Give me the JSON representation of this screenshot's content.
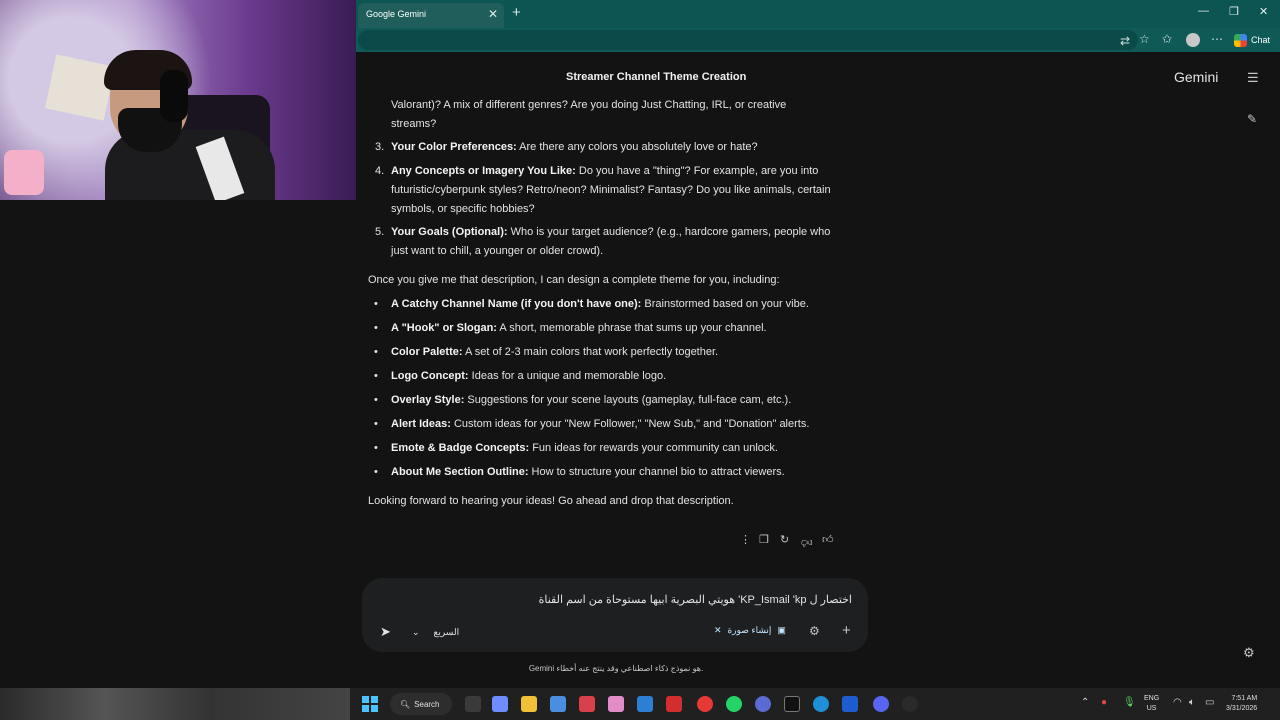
{
  "browser": {
    "tab_title": "Google Gemini",
    "tab_close": "✕",
    "new_tab": "+",
    "window_controls": [
      "—",
      "❐",
      "✕"
    ],
    "chat_label": "Chat"
  },
  "header": {
    "conversation_title": "Streamer Channel Theme Creation",
    "brand": "Gemini"
  },
  "response": {
    "continued_line_1": "Valorant)? A mix of different genres? Are you doing Just Chatting, IRL, or creative",
    "continued_line_2": "streams?",
    "numbered": [
      {
        "num": "3.",
        "label": "Your Color Preferences:",
        "line1": " Are there any colors you absolutely love or hate?",
        "line2": "",
        "line3": ""
      },
      {
        "num": "4.",
        "label": "Any Concepts or Imagery You Like:",
        "line1": " Do you have a \"thing\"? For example, are you into",
        "line2": "futuristic/cyberpunk styles? Retro/neon? Minimalist? Fantasy? Do you like animals, certain",
        "line3": "symbols, or specific hobbies?"
      },
      {
        "num": "5.",
        "label": "Your Goals (Optional):",
        "line1": " Who is your target audience? (e.g., hardcore gamers, people who",
        "line2": "just want to chill, a younger or older crowd).",
        "line3": ""
      }
    ],
    "intro": "Once you give me that description, I can design a complete theme for you, including:",
    "bullets": [
      {
        "label": "A Catchy Channel Name (if you don't have one):",
        "text": " Brainstormed based on your vibe."
      },
      {
        "label": "A \"Hook\" or Slogan:",
        "text": " A short, memorable phrase that sums up your channel."
      },
      {
        "label": "Color Palette:",
        "text": " A set of 2-3 main colors that work perfectly together."
      },
      {
        "label": "Logo Concept:",
        "text": " Ideas for a unique and memorable logo."
      },
      {
        "label": "Overlay Style:",
        "text": " Suggestions for your scene layouts (gameplay, full-face cam, etc.)."
      },
      {
        "label": "Alert Ideas:",
        "text": " Custom ideas for your \"New Follower,\" \"New Sub,\" and \"Donation\" alerts."
      },
      {
        "label": "Emote & Badge Concepts:",
        "text": " Fun ideas for rewards your community can unlock."
      },
      {
        "label": "About Me Section Outline:",
        "text": " How to structure your channel bio to attract viewers."
      }
    ],
    "closing": "Looking forward to hearing your ideas! Go ahead and drop that description."
  },
  "input": {
    "value": "هويتي البصرية ابيها مستوحاة من اسم القناة 'KP_Ismail 'kp اختصار ل",
    "model": "السريع",
    "chip_label": "إنشاء صورة",
    "chip_close": "✕"
  },
  "disclaimer": "Gemini هو نموذج ذكاء اصطناعي وقد ينتج عنه أخطاء.",
  "taskbar": {
    "search_label": "Search",
    "lang_top": "ENG",
    "lang_bottom": "US",
    "time": "7:51 AM",
    "date": "3/31/2026"
  }
}
